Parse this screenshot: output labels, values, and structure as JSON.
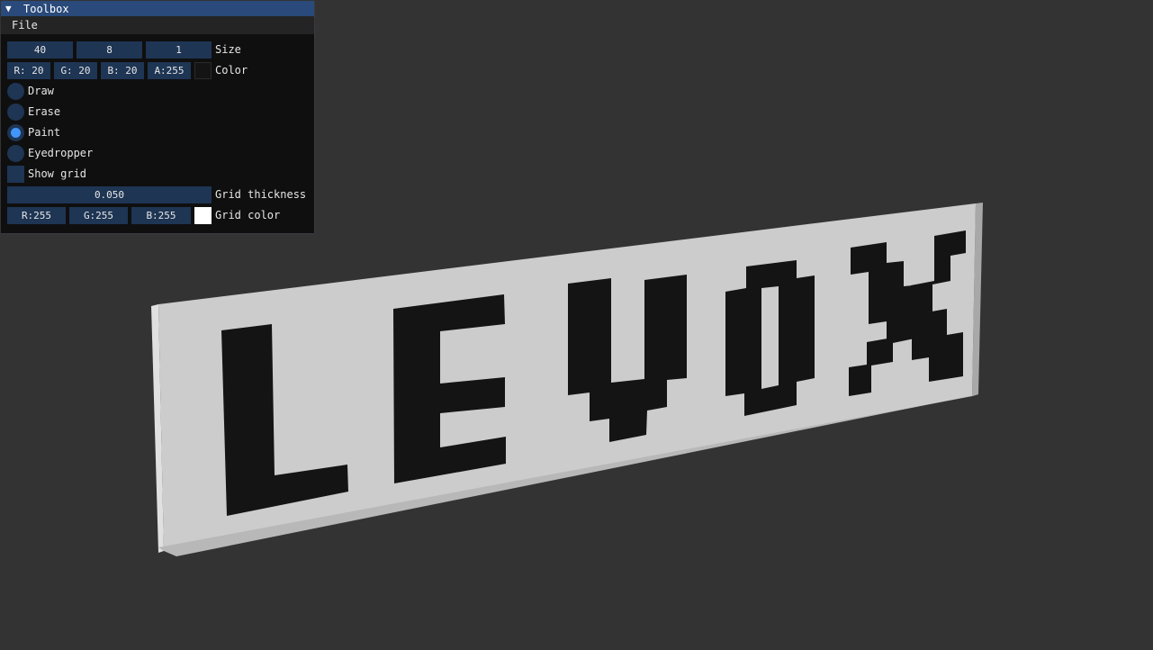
{
  "window": {
    "title": "Toolbox",
    "collapse_arrow": "▼",
    "menu": [
      "File"
    ]
  },
  "size": {
    "values": [
      "40",
      "8",
      "1"
    ],
    "label": "Size"
  },
  "color": {
    "fields": [
      "R: 20",
      "G: 20",
      "B: 20",
      "A:255"
    ],
    "label": "Color",
    "swatch": "#141414"
  },
  "tools": {
    "items": [
      {
        "label": "Draw",
        "selected": false
      },
      {
        "label": "Erase",
        "selected": false
      },
      {
        "label": "Paint",
        "selected": true
      },
      {
        "label": "Eyedropper",
        "selected": false
      }
    ]
  },
  "grid": {
    "show_label": "Show grid",
    "show_checked": false,
    "thickness_value": "0.050",
    "thickness_label": "Grid thickness",
    "color_fields": [
      "R:255",
      "G:255",
      "B:255"
    ],
    "color_label": "Grid color",
    "color_swatch": "#ffffff"
  },
  "scene": {
    "text": "LEVOX",
    "background": "#333333",
    "board_face": "#cccccc",
    "board_side": "#e0e0e0",
    "voxel_color": "#141414"
  },
  "colors": {
    "title_bar": "#294a7a",
    "frame_bg": "#1e3554",
    "radio_active": "#4296fa"
  }
}
